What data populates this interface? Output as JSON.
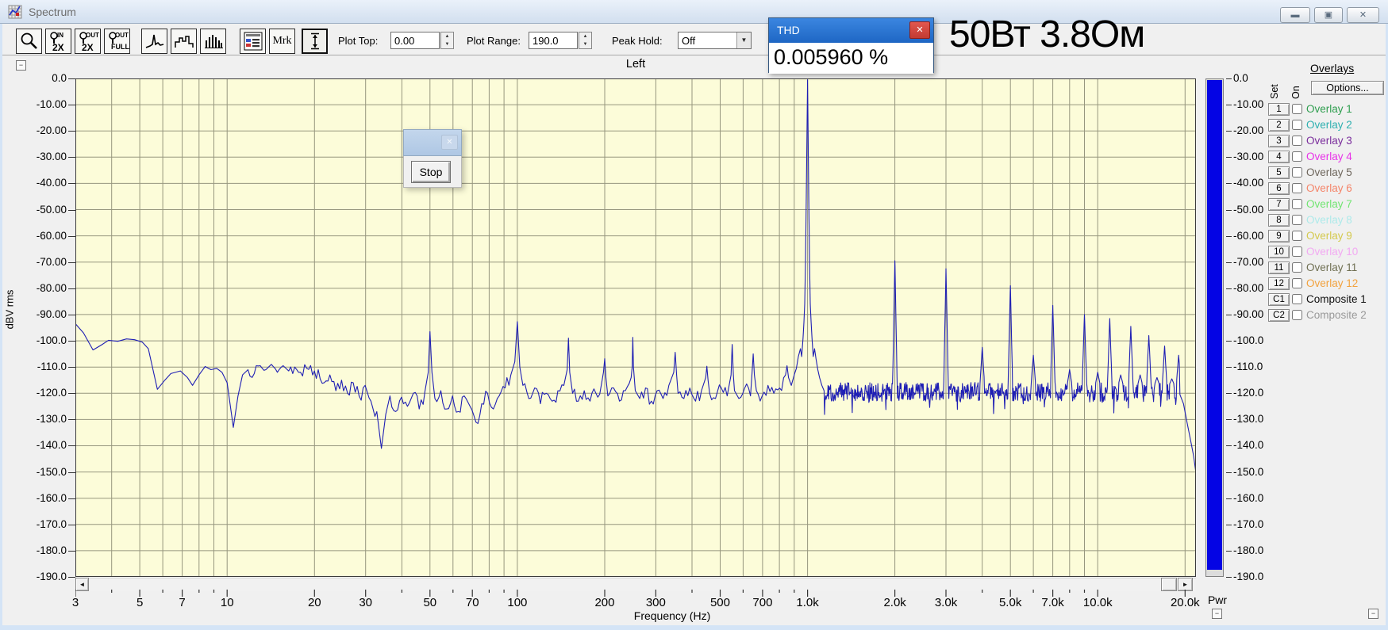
{
  "window": {
    "title": "Spectrum"
  },
  "toolbar": {
    "buttons": {
      "zoom_in_2x": {
        "tag": "IN",
        "label": "2X"
      },
      "zoom_out_2x": {
        "tag": "OUT",
        "label": "2X"
      },
      "zoom_out_full": {
        "tag": "OUT",
        "label": "FULL"
      },
      "marker": {
        "label": "Mrk"
      }
    },
    "plot_top_label": "Plot Top:",
    "plot_top_value": "0.00",
    "plot_range_label": "Plot Range:",
    "plot_range_value": "190.0",
    "peak_hold_label": "Peak Hold:",
    "peak_hold_value": "Off"
  },
  "thd": {
    "title": "THD",
    "value": "0.005960 %"
  },
  "annotation": "50Вт 3.8Ом",
  "stop_dialog": {
    "button": "Stop"
  },
  "pwr": {
    "label": "Pwr",
    "color": "#0404e4"
  },
  "overlays": {
    "header": "Overlays",
    "options_button": "Options...",
    "set_col": "Set",
    "on_col": "On",
    "items": [
      {
        "id": "1",
        "label": "Overlay 1",
        "color": "#2f9e4f"
      },
      {
        "id": "2",
        "label": "Overlay 2",
        "color": "#2fb0b0"
      },
      {
        "id": "3",
        "label": "Overlay 3",
        "color": "#7a2d9c"
      },
      {
        "id": "4",
        "label": "Overlay 4",
        "color": "#e832e8"
      },
      {
        "id": "5",
        "label": "Overlay 5",
        "color": "#6e665c"
      },
      {
        "id": "6",
        "label": "Overlay 6",
        "color": "#f4856a"
      },
      {
        "id": "7",
        "label": "Overlay 7",
        "color": "#72e572"
      },
      {
        "id": "8",
        "label": "Overlay 8",
        "color": "#aeeaea"
      },
      {
        "id": "9",
        "label": "Overlay 9",
        "color": "#d4c94e"
      },
      {
        "id": "10",
        "label": "Overlay 10",
        "color": "#f2aaf2"
      },
      {
        "id": "11",
        "label": "Overlay 11",
        "color": "#6f6f52"
      },
      {
        "id": "12",
        "label": "Overlay 12",
        "color": "#f2a23e"
      },
      {
        "id": "C1",
        "label": "Composite 1",
        "color": "#111111"
      },
      {
        "id": "C2",
        "label": "Composite 2",
        "color": "#999999"
      }
    ]
  },
  "chart_data": {
    "type": "line",
    "title": "Left",
    "xlabel": "Frequency (Hz)",
    "ylabel": "dBV rms",
    "x_scale": "log",
    "xlim": [
      3,
      21800
    ],
    "ylim": [
      -190,
      0
    ],
    "plot_bg": "#fcfcd9",
    "grid_color": "#96967e",
    "line_color": "#1f1fb4",
    "x_ticks": [
      [
        3,
        "3"
      ],
      [
        5,
        "5"
      ],
      [
        7,
        "7"
      ],
      [
        10,
        "10"
      ],
      [
        20,
        "20"
      ],
      [
        30,
        "30"
      ],
      [
        50,
        "50"
      ],
      [
        70,
        "70"
      ],
      [
        100,
        "100"
      ],
      [
        200,
        "200"
      ],
      [
        300,
        "300"
      ],
      [
        500,
        "500"
      ],
      [
        700,
        "700"
      ],
      [
        1000,
        "1.0k"
      ],
      [
        2000,
        "2.0k"
      ],
      [
        3000,
        "3.0k"
      ],
      [
        5000,
        "5.0k"
      ],
      [
        7000,
        "7.0k"
      ],
      [
        10000,
        "10.0k"
      ],
      [
        20000,
        "20.0k"
      ]
    ],
    "y_tick_labels": [
      "0.0",
      "-10.00",
      "-20.00",
      "-30.00",
      "-40.00",
      "-50.00",
      "-60.00",
      "-70.00",
      "-80.00",
      "-90.00",
      "-100.0",
      "-110.0",
      "-120.0",
      "-130.0",
      "-140.0",
      "-150.0",
      "-160.0",
      "-170.0",
      "-180.0",
      "-190.0"
    ],
    "fundamental_hz": 1000,
    "thd_percent": 0.00596,
    "baseline_points": [
      [
        3,
        -93.5
      ],
      [
        3.2,
        -97
      ],
      [
        3.45,
        -103.5
      ],
      [
        3.7,
        -101.5
      ],
      [
        3.9,
        -99.8
      ],
      [
        4.2,
        -100.2
      ],
      [
        4.5,
        -99.3
      ],
      [
        4.8,
        -99.6
      ],
      [
        5.1,
        -100.5
      ],
      [
        5.35,
        -103
      ],
      [
        5.75,
        -118.5
      ],
      [
        6.1,
        -115
      ],
      [
        6.4,
        -112.5
      ],
      [
        6.9,
        -111.5
      ],
      [
        7.3,
        -114
      ],
      [
        7.6,
        -117
      ],
      [
        8,
        -113
      ],
      [
        8.4,
        -109.8
      ],
      [
        8.8,
        -111
      ],
      [
        9.2,
        -110.5
      ],
      [
        9.6,
        -112
      ],
      [
        10,
        -116
      ],
      [
        10.5,
        -133
      ],
      [
        10.9,
        -121
      ],
      [
        11.3,
        -113
      ],
      [
        11.8,
        -111
      ],
      [
        12.4,
        -112.5
      ],
      [
        13,
        -109.5
      ],
      [
        13.6,
        -111
      ],
      [
        14.2,
        -109
      ],
      [
        14.9,
        -112
      ],
      [
        15.6,
        -109.5
      ],
      [
        16.3,
        -111.5
      ],
      [
        17.1,
        -110
      ],
      [
        17.9,
        -112
      ],
      [
        18.8,
        -110.5
      ],
      [
        19.7,
        -113
      ],
      [
        20.6,
        -111
      ],
      [
        21.6,
        -116
      ],
      [
        22.6,
        -113
      ],
      [
        23.7,
        -119
      ],
      [
        24.8,
        -115
      ],
      [
        26,
        -120
      ],
      [
        27.2,
        -116
      ],
      [
        28.5,
        -121
      ],
      [
        29.9,
        -117
      ],
      [
        31.3,
        -123
      ],
      [
        32.8,
        -127
      ],
      [
        34,
        -141
      ],
      [
        35.2,
        -128
      ],
      [
        36.4,
        -121
      ],
      [
        38.1,
        -127
      ],
      [
        39.9,
        -121.5
      ],
      [
        41.8,
        -125
      ],
      [
        43.8,
        -120
      ],
      [
        45.9,
        -126
      ],
      [
        48.1,
        -119
      ],
      [
        49.3,
        -112
      ],
      [
        50,
        -96.5
      ],
      [
        50.8,
        -112
      ],
      [
        52,
        -122
      ],
      [
        54.5,
        -119
      ],
      [
        57.1,
        -126
      ],
      [
        59.8,
        -121
      ],
      [
        62.6,
        -127
      ],
      [
        65.6,
        -121
      ],
      [
        68.7,
        -125
      ],
      [
        72,
        -131
      ],
      [
        75.4,
        -124
      ],
      [
        79,
        -120
      ],
      [
        82.7,
        -126
      ],
      [
        86.6,
        -121
      ],
      [
        90.7,
        -118
      ],
      [
        95,
        -113
      ],
      [
        98,
        -108
      ],
      [
        100,
        -92.7
      ],
      [
        102,
        -110
      ],
      [
        104.5,
        -117
      ],
      [
        109.5,
        -122
      ],
      [
        114.7,
        -118
      ],
      [
        120.1,
        -124
      ],
      [
        125.8,
        -120
      ],
      [
        131.8,
        -123
      ],
      [
        138,
        -119
      ],
      [
        144.6,
        -117
      ],
      [
        148.5,
        -111
      ],
      [
        150,
        -99
      ],
      [
        151.5,
        -112
      ],
      [
        155,
        -120
      ],
      [
        162.3,
        -123
      ],
      [
        170,
        -119
      ],
      [
        178,
        -123
      ],
      [
        186.5,
        -120
      ],
      [
        195.3,
        -116
      ],
      [
        198,
        -112
      ],
      [
        200,
        -106.8
      ],
      [
        202,
        -114
      ],
      [
        205,
        -121
      ],
      [
        214.7,
        -118
      ],
      [
        224.9,
        -123
      ],
      [
        235.6,
        -119
      ],
      [
        246.7,
        -114
      ],
      [
        248.8,
        -110
      ],
      [
        250,
        -98.7
      ],
      [
        251.2,
        -110
      ],
      [
        255,
        -119
      ],
      [
        264,
        -122
      ],
      [
        276.5,
        -118
      ],
      [
        289.6,
        -123
      ],
      [
        303.3,
        -119
      ],
      [
        317.7,
        -122
      ],
      [
        332.7,
        -117
      ],
      [
        346,
        -112
      ],
      [
        350,
        -104.4
      ],
      [
        354,
        -113
      ],
      [
        358,
        -120
      ],
      [
        375,
        -122
      ],
      [
        392.8,
        -118
      ],
      [
        411.4,
        -123
      ],
      [
        430.9,
        -119
      ],
      [
        446,
        -114
      ],
      [
        450,
        -109.7
      ],
      [
        454,
        -115
      ],
      [
        460,
        -120
      ],
      [
        481.8,
        -122
      ],
      [
        504.6,
        -118
      ],
      [
        528.5,
        -121
      ],
      [
        545,
        -113
      ],
      [
        550,
        -101.4
      ],
      [
        555,
        -113
      ],
      [
        560,
        -119
      ],
      [
        579.9,
        -122
      ],
      [
        607.3,
        -118
      ],
      [
        636.1,
        -121
      ],
      [
        644,
        -112
      ],
      [
        650,
        -105
      ],
      [
        656,
        -113
      ],
      [
        666.2,
        -119
      ],
      [
        697.7,
        -121
      ],
      [
        730.7,
        -117
      ],
      [
        765.3,
        -120
      ],
      [
        801.5,
        -118
      ],
      [
        840,
        -113
      ],
      [
        850,
        -109.5
      ],
      [
        860,
        -114
      ],
      [
        879.3,
        -117
      ],
      [
        900,
        -113
      ],
      [
        915,
        -110.5
      ],
      [
        930,
        -106
      ],
      [
        945,
        -103
      ],
      [
        955,
        -106
      ],
      [
        965,
        -99
      ],
      [
        972,
        -93
      ],
      [
        978,
        -86
      ],
      [
        984,
        -70
      ],
      [
        990,
        -45
      ],
      [
        1000,
        -0.5
      ],
      [
        1010,
        -45
      ],
      [
        1016,
        -70
      ],
      [
        1022,
        -86
      ],
      [
        1029,
        -93
      ],
      [
        1036,
        -99
      ],
      [
        1046,
        -106
      ],
      [
        1057,
        -103
      ],
      [
        1070,
        -107
      ],
      [
        1085,
        -111
      ],
      [
        1100,
        -114
      ],
      [
        1120,
        -117
      ],
      [
        1140,
        -119
      ]
    ],
    "harmonics": [
      [
        2000,
        -69.5
      ],
      [
        3000,
        -72.5
      ],
      [
        4000,
        -102.5
      ],
      [
        5000,
        -79
      ],
      [
        6000,
        -105.5
      ],
      [
        7000,
        -86.5
      ],
      [
        8000,
        -111
      ],
      [
        9000,
        -90
      ],
      [
        10000,
        -112
      ],
      [
        11000,
        -91.5
      ],
      [
        12000,
        -113
      ],
      [
        13000,
        -94.5
      ],
      [
        14000,
        -113
      ],
      [
        15000,
        -98
      ],
      [
        16000,
        -114
      ],
      [
        17000,
        -102
      ],
      [
        18000,
        -114.5
      ],
      [
        19000,
        -105.5
      ]
    ],
    "noise": {
      "from": 1140,
      "to": 19150,
      "floor": -119.5,
      "jitter": 3.6,
      "step": 1.004,
      "seed": 1337
    },
    "lowfreq_jitter": {
      "from": 11,
      "to": 950,
      "amp": 3.2
    },
    "rolloff_points": [
      [
        19200,
        -120.5
      ],
      [
        19750,
        -124
      ],
      [
        20300,
        -131
      ],
      [
        20900,
        -138
      ],
      [
        21400,
        -144
      ],
      [
        21800,
        -150.5
      ]
    ]
  }
}
